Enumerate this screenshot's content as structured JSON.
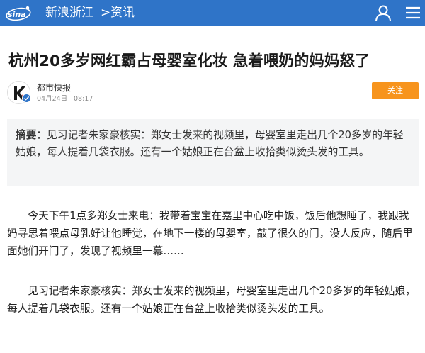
{
  "header": {
    "logo_text": "sina",
    "site": "新浪浙江",
    "chevron": ">",
    "channel": "资讯",
    "user_icon": "user-icon",
    "menu_icon": "menu-icon",
    "bg_color": "#2f74c8"
  },
  "article": {
    "title": "杭州20多岁网红霸占母婴室化妆 急着喂奶的妈妈怒了",
    "author": "都市快报",
    "date": "04月24日",
    "time": "08:17",
    "follow_label": "关注",
    "follow_color": "#f7941d",
    "summary_label": "摘要：",
    "summary_text": "见习记者朱家豪核实：郑女士发来的视频里，母婴室里走出几个20多岁的年轻姑娘，每人提着几袋衣服。还有一个姑娘正在台盆上收拾类似烫头发的工具。",
    "paragraphs": [
      "今天下午1点多郑女士来电：我带着宝宝在嘉里中心吃中饭，饭后他想睡了，我跟我妈寻思着喂点母乳好让他睡觉，在地下一楼的母婴室，敲了很久的门，没人反应，随后里面她们开门了，发现了视频里一幕……",
      "见习记者朱家豪核实：郑女士发来的视频里，母婴室里走出几个20多岁的年轻姑娘，每人提着几袋衣服。还有一个姑娘正在台盆上收拾类似烫头发的工具。"
    ]
  }
}
